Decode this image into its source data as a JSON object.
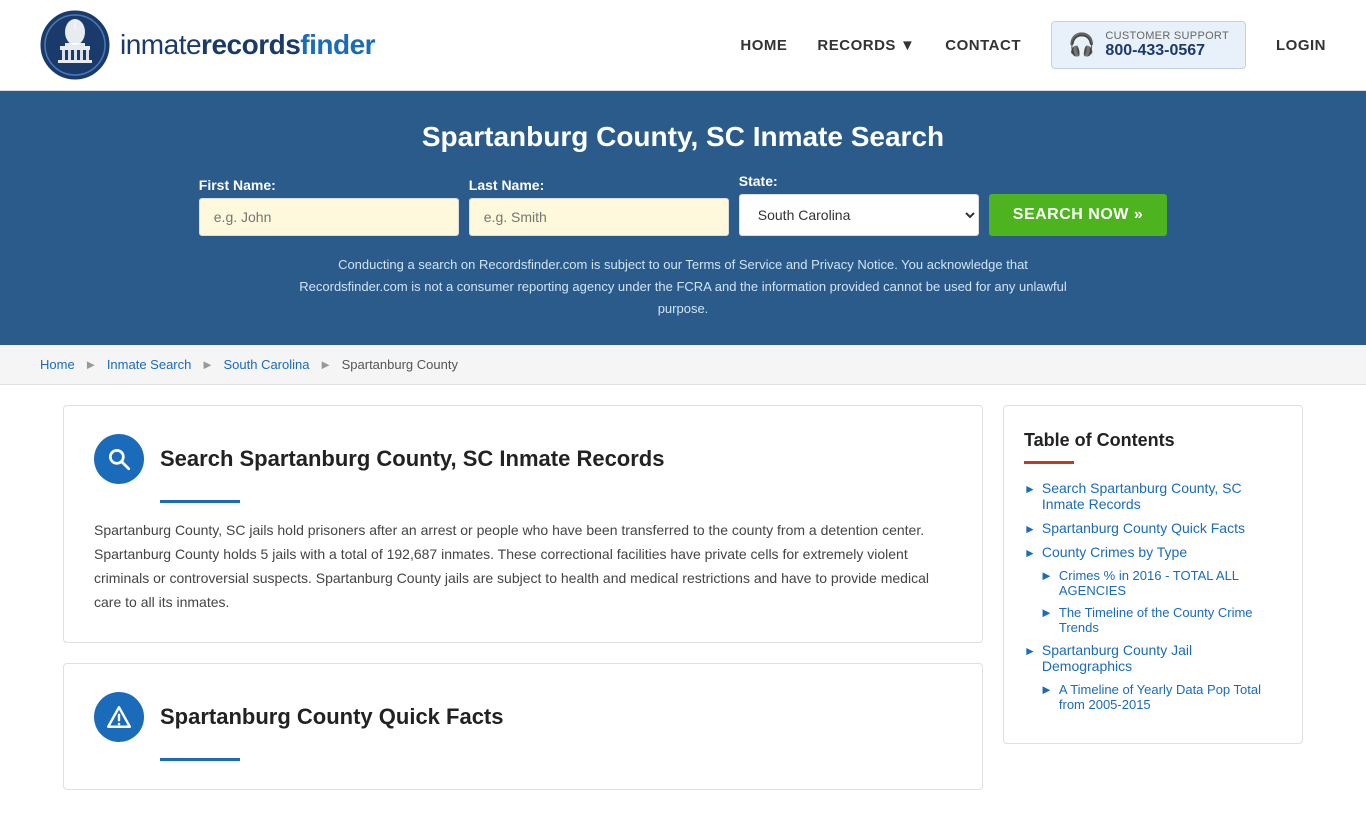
{
  "header": {
    "logo_text_inmate": "inmate",
    "logo_text_records": "records",
    "logo_text_finder": "finder",
    "nav": {
      "home": "HOME",
      "records": "RECORDS",
      "contact": "CONTACT",
      "login": "LOGIN",
      "support_label": "CUSTOMER SUPPORT",
      "support_number": "800-433-0567"
    }
  },
  "hero": {
    "title": "Spartanburg County, SC Inmate Search",
    "first_name_label": "First Name:",
    "first_name_placeholder": "e.g. John",
    "last_name_label": "Last Name:",
    "last_name_placeholder": "e.g. Smith",
    "state_label": "State:",
    "state_value": "South Carolina",
    "search_button": "SEARCH NOW »",
    "disclaimer": "Conducting a search on Recordsfinder.com is subject to our Terms of Service and Privacy Notice. You acknowledge that Recordsfinder.com is not a consumer reporting agency under the FCRA and the information provided cannot be used for any unlawful purpose."
  },
  "breadcrumb": {
    "home": "Home",
    "inmate_search": "Inmate Search",
    "state": "South Carolina",
    "county": "Spartanburg County"
  },
  "main_section": {
    "card1": {
      "title": "Search Spartanburg County, SC Inmate Records",
      "body": "Spartanburg County, SC jails hold prisoners after an arrest or people who have been transferred to the county from a detention center. Spartanburg County holds 5 jails with a total of 192,687 inmates. These correctional facilities have private cells for extremely violent criminals or controversial suspects. Spartanburg County jails are subject to health and medical restrictions and have to provide medical care to all its inmates."
    },
    "card2": {
      "title": "Spartanburg County Quick Facts"
    }
  },
  "toc": {
    "title": "Table of Contents",
    "items": [
      {
        "label": "Search Spartanburg County, SC Inmate Records",
        "sub": []
      },
      {
        "label": "Spartanburg County Quick Facts",
        "sub": []
      },
      {
        "label": "County Crimes by Type",
        "sub": []
      },
      {
        "label": "Crimes % in 2016 - TOTAL ALL AGENCIES",
        "sub": []
      },
      {
        "label": "The Timeline of the County Crime Trends",
        "sub": []
      },
      {
        "label": "Spartanburg County Jail Demographics",
        "sub": []
      },
      {
        "label": "A Timeline of Yearly Data Pop Total from 2005-2015",
        "sub": []
      }
    ]
  }
}
